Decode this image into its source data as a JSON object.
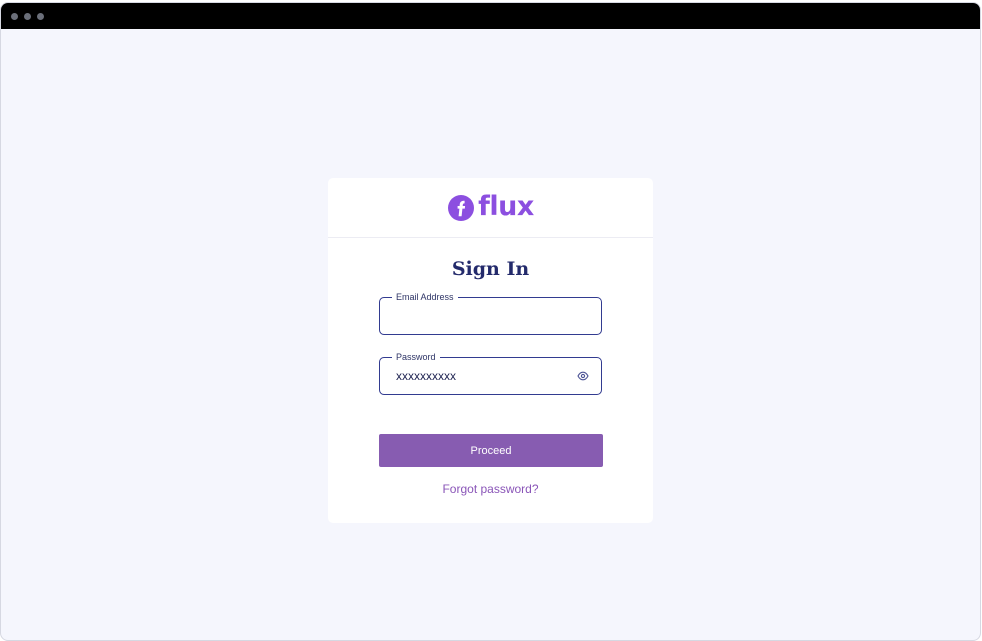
{
  "browser": {
    "dots": [
      "dot",
      "dot",
      "dot"
    ]
  },
  "brand": {
    "logo_icon": "flux-f-logo-icon",
    "name": "flux",
    "color": "#8c4fe0"
  },
  "signin": {
    "title": "Sign In",
    "email_label": "Email Address",
    "email_value": "",
    "password_label": "Password",
    "password_value": "xxxxxxxxxx",
    "toggle_icon": "eye-icon",
    "proceed_label": "Proceed",
    "forgot_label": "Forgot password?"
  },
  "colors": {
    "accent": "#875cb1",
    "title": "#232a6b",
    "field_border": "#323b90",
    "background": "#f5f6fd"
  }
}
